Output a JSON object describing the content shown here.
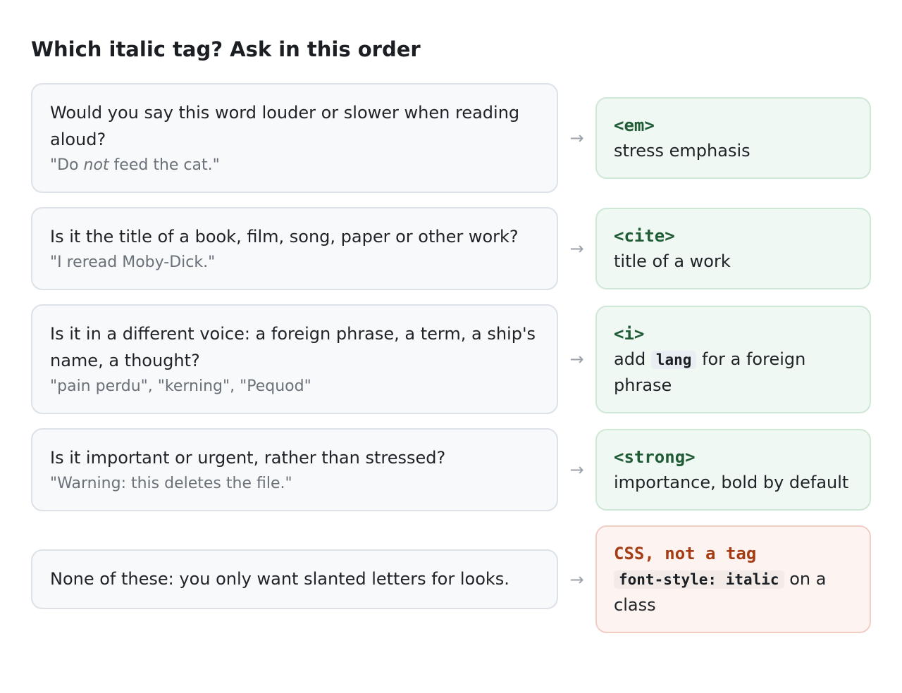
{
  "heading": "Which italic tag? Ask in this order",
  "rows": [
    {
      "question": "Would you say this word louder or slower when reading aloud?",
      "example_before": "\"Do ",
      "example_em": "not",
      "example_after": " feed the cat.\"",
      "arrow": "→",
      "tag": "<em>",
      "desc": "stress emphasis"
    },
    {
      "question": "Is it the title of a book, film, song, paper or other work?",
      "example": "\"I reread Moby-Dick.\"",
      "arrow": "→",
      "tag": "<cite>",
      "desc": "title of a work"
    },
    {
      "question": "Is it in a different voice: a foreign phrase, a term, a ship's name, a thought?",
      "example": "\"pain perdu\", \"kerning\", \"Pequod\"",
      "arrow": "→",
      "tag": "<i>",
      "desc_before": "add ",
      "desc_code": "lang",
      "desc_after": " for a foreign phrase"
    },
    {
      "question": "Is it important or urgent, rather than stressed?",
      "example": "\"Warning: this deletes the file.\"",
      "arrow": "→",
      "tag": "<strong>",
      "desc": "importance, bold by default"
    },
    {
      "question": "None of these: you only want slanted letters for looks.",
      "arrow": "→",
      "tag": "CSS, not a tag",
      "desc_code": "font-style: italic",
      "desc_after": " on a class"
    }
  ],
  "colors": {
    "tag_green": "#1f5c35",
    "tag_red": "#a43d14",
    "answer_green_bg": "#eff8f2",
    "answer_red_bg": "#fdf4f2",
    "question_bg": "#f7f9fb"
  }
}
